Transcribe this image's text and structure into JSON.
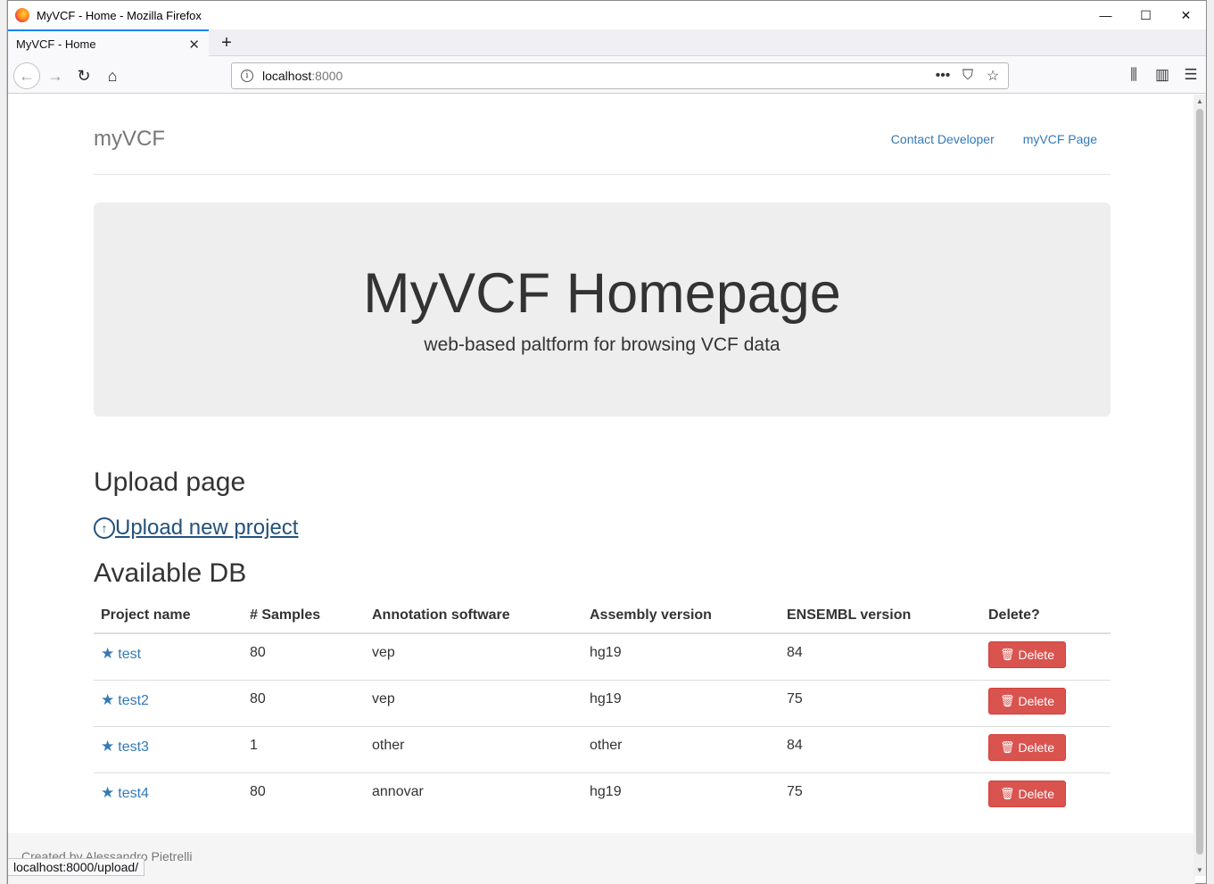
{
  "window": {
    "title": "MyVCF - Home - Mozilla Firefox",
    "controls": {
      "minimize": "—",
      "maximize": "☐",
      "close": "✕"
    }
  },
  "tabs": [
    {
      "label": "MyVCF - Home",
      "close": "✕"
    }
  ],
  "newtab": "+",
  "nav": {
    "back": "←",
    "forward": "→",
    "reload": "↻",
    "home": "⌂",
    "url_host": "localhost",
    "url_port": ":8000",
    "info": "i",
    "more": "•••",
    "pocket": "⛉",
    "bookmark": "☆",
    "library": "⫼",
    "sidebar": "▥",
    "menu": "☰"
  },
  "site": {
    "brand": "myVCF",
    "nav_links": [
      "Contact Developer",
      "myVCF Page"
    ]
  },
  "jumbotron": {
    "title": "MyVCF Homepage",
    "subtitle": "web-based paltform for browsing VCF data"
  },
  "upload": {
    "heading": "Upload page",
    "icon": "↑",
    "link": "Upload new project"
  },
  "db": {
    "heading": "Available DB",
    "columns": [
      "Project name",
      "# Samples",
      "Annotation software",
      "Assembly version",
      "ENSEMBL version",
      "Delete?"
    ],
    "rows": [
      {
        "name": "test",
        "samples": "80",
        "software": "vep",
        "assembly": "hg19",
        "ensembl": "84",
        "delete": "Delete"
      },
      {
        "name": "test2",
        "samples": "80",
        "software": "vep",
        "assembly": "hg19",
        "ensembl": "75",
        "delete": "Delete"
      },
      {
        "name": "test3",
        "samples": "1",
        "software": "other",
        "assembly": "other",
        "ensembl": "84",
        "delete": "Delete"
      },
      {
        "name": "test4",
        "samples": "80",
        "software": "annovar",
        "assembly": "hg19",
        "ensembl": "75",
        "delete": "Delete"
      }
    ]
  },
  "footer": {
    "credit": "Created by Alessandro Pietrelli"
  },
  "status": {
    "url": "localhost:8000/upload/"
  },
  "icons": {
    "star": "★",
    "trash": "🗑"
  },
  "colors": {
    "link": "#337ab7",
    "danger": "#d9534f",
    "jumbotron_bg": "#eeeeee",
    "firefox_accent": "#0a84ff"
  }
}
